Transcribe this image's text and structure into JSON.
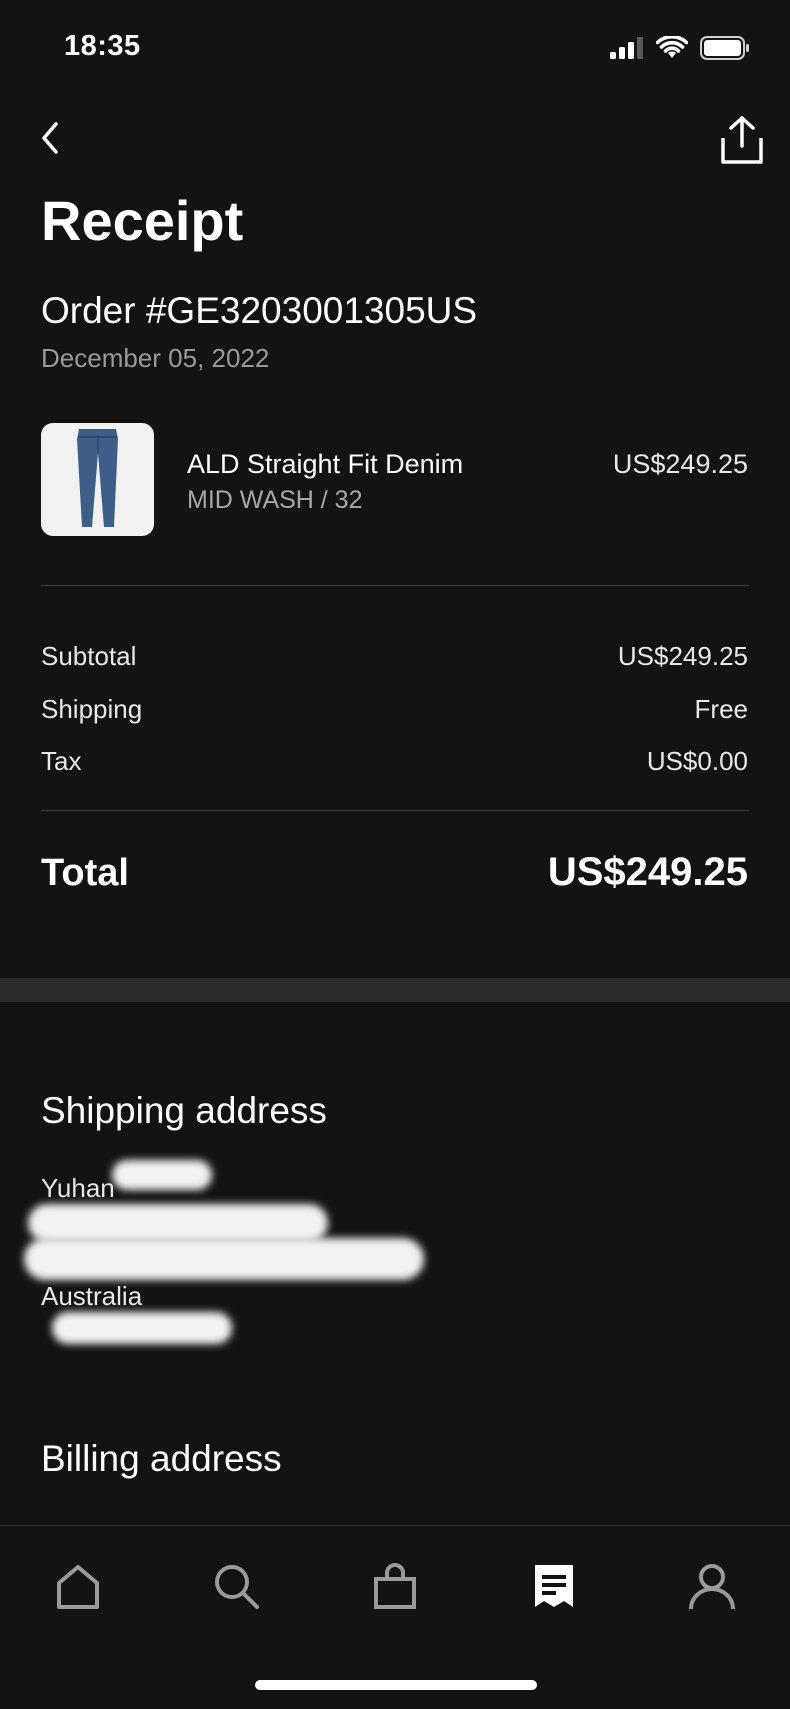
{
  "status_bar": {
    "time": "18:35"
  },
  "header": {
    "title": "Receipt"
  },
  "order": {
    "number": "Order #GE3203001305US",
    "date": "December 05, 2022"
  },
  "item": {
    "name": "ALD Straight Fit Denim",
    "variant": "MID WASH / 32",
    "price": "US$249.25"
  },
  "summary": {
    "subtotal_label": "Subtotal",
    "subtotal_value": "US$249.25",
    "shipping_label": "Shipping",
    "shipping_value": "Free",
    "tax_label": "Tax",
    "tax_value": "US$0.00",
    "total_label": "Total",
    "total_value": "US$249.25"
  },
  "shipping_address": {
    "heading": "Shipping address",
    "lines": [
      "Yuhan",
      "",
      "",
      "Australia",
      ""
    ]
  },
  "billing_address": {
    "heading": "Billing address"
  },
  "tabs": [
    "home-icon",
    "search-icon",
    "bag-icon",
    "receipt-icon",
    "profile-icon"
  ],
  "colors": {
    "background": "#131313",
    "muted_text": "#9a9a9a",
    "divider": "#3a3a3a"
  }
}
